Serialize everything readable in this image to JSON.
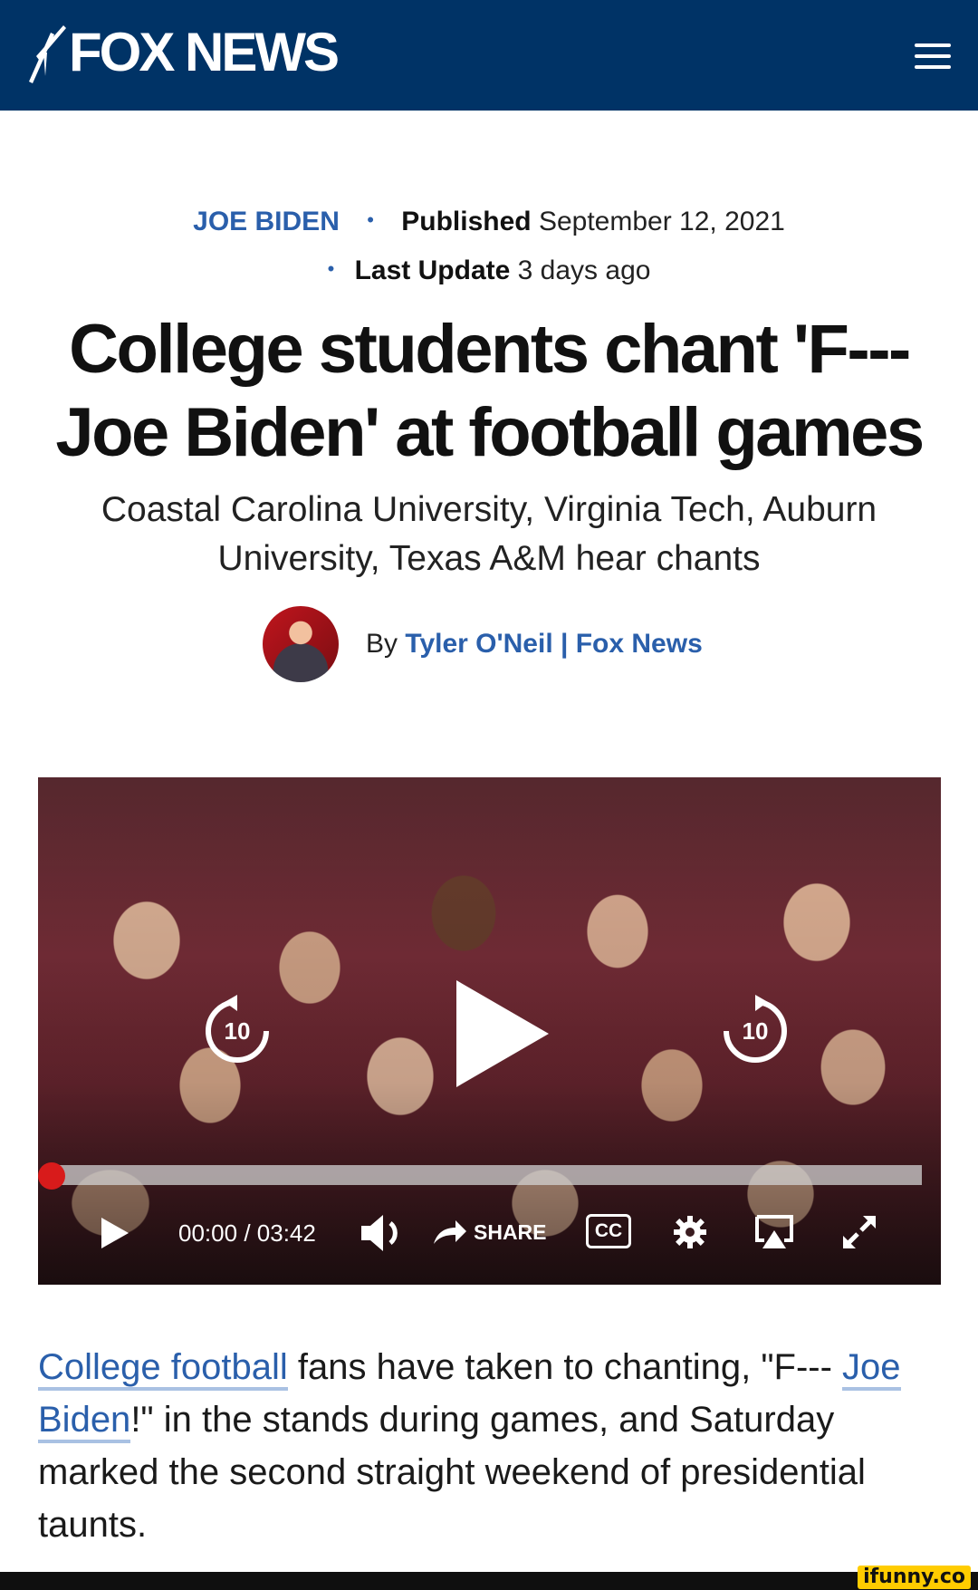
{
  "header": {
    "logo_text": "FOX NEWS",
    "menu_icon": "hamburger-menu-icon",
    "background": "#003366"
  },
  "meta": {
    "category": "JOE BIDEN",
    "published_label": "Published",
    "published_date": "September 12, 2021",
    "updated_label": "Last Update",
    "updated_value": "3 days ago"
  },
  "article": {
    "headline": "College students chant 'F--- Joe Biden' at football games",
    "subheadline": "Coastal Carolina University, Virginia Tech, Auburn University, Texas A&M hear chants",
    "byline_prefix": "By",
    "author": "Tyler O'Neil | Fox News"
  },
  "video": {
    "rewind_label": "10",
    "forward_label": "10",
    "current_time": "00:00",
    "separator": "/",
    "duration": "03:42",
    "share_label": "SHARE",
    "cc_label": "CC",
    "progress": 0.0
  },
  "body": {
    "link1": "College football",
    "text1": " fans have taken to chanting, \"F--- ",
    "link2": "Joe Biden",
    "text2": "!\" in the stands during games, and Saturday marked the second straight weekend of presidential taunts."
  },
  "watermark": "ifunny.co",
  "colors": {
    "brand_navy": "#003366",
    "link_blue": "#2a5fab",
    "progress_red": "#d81b1b"
  }
}
